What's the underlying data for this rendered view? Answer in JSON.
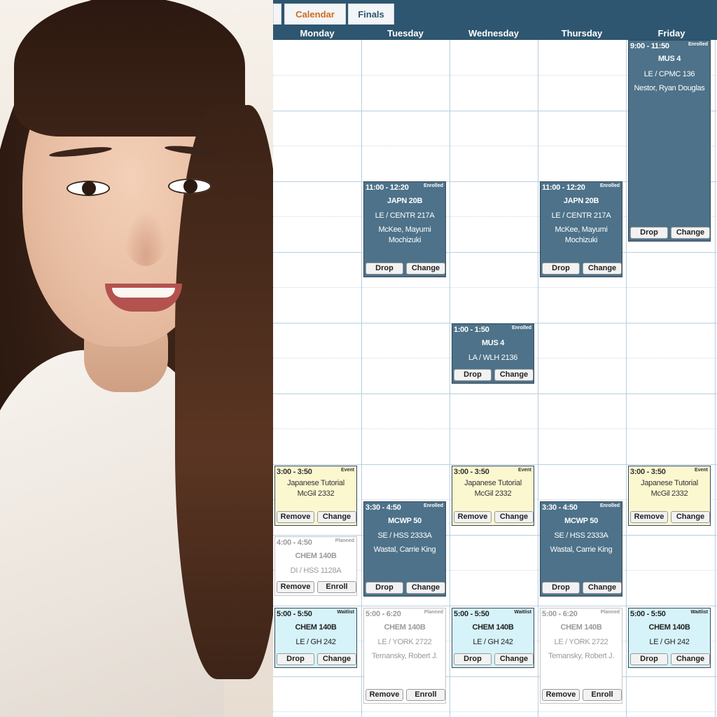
{
  "tabs": {
    "calendar": "Calendar",
    "finals": "Finals"
  },
  "days": [
    "Monday",
    "Tuesday",
    "Wednesday",
    "Thursday",
    "Friday"
  ],
  "events": {
    "fri_mus4": {
      "time": "9:00 - 11:50",
      "status": "Enrolled",
      "title": "MUS 4",
      "loc": "LE / CPMC 136",
      "instr": "Nestor, Ryan Douglas",
      "b1": "Drop",
      "b2": "Change"
    },
    "tue_japn": {
      "time": "11:00 - 12:20",
      "status": "Enrolled",
      "title": "JAPN 20B",
      "loc": "LE / CENTR 217A",
      "instr1": "McKee, Mayumi",
      "instr2": "Mochizuki",
      "b1": "Drop",
      "b2": "Change"
    },
    "thu_japn": {
      "time": "11:00 - 12:20",
      "status": "Enrolled",
      "title": "JAPN 20B",
      "loc": "LE / CENTR 217A",
      "instr1": "McKee, Mayumi",
      "instr2": "Mochizuki",
      "b1": "Drop",
      "b2": "Change"
    },
    "wed_mus4": {
      "time": "1:00 - 1:50",
      "status": "Enrolled",
      "title": "MUS 4",
      "loc": "LA / WLH 2136",
      "b1": "Drop",
      "b2": "Change"
    },
    "mon_tut": {
      "time": "3:00 - 3:50",
      "status": "Event",
      "title": "Japanese Tutorial",
      "loc": "McGil 2332",
      "b1": "Remove",
      "b2": "Change"
    },
    "wed_tut": {
      "time": "3:00 - 3:50",
      "status": "Event",
      "title": "Japanese Tutorial",
      "loc": "McGil 2332",
      "b1": "Remove",
      "b2": "Change"
    },
    "fri_tut": {
      "time": "3:00 - 3:50",
      "status": "Event",
      "title": "Japanese Tutorial",
      "loc": "McGil 2332",
      "b1": "Remove",
      "b2": "Change"
    },
    "tue_mcwp": {
      "time": "3:30 - 4:50",
      "status": "Enrolled",
      "title": "MCWP 50",
      "loc": "SE / HSS 2333A",
      "instr": "Wastal, Carrie King",
      "b1": "Drop",
      "b2": "Change"
    },
    "thu_mcwp": {
      "time": "3:30 - 4:50",
      "status": "Enrolled",
      "title": "MCWP 50",
      "loc": "SE / HSS 2333A",
      "instr": "Wastal, Carrie King",
      "b1": "Drop",
      "b2": "Change"
    },
    "mon_chem_di": {
      "time": "4:00 - 4:50",
      "status": "Planned",
      "title": "CHEM 140B",
      "loc": "DI / HSS 1128A",
      "b1": "Remove",
      "b2": "Enroll"
    },
    "mon_chem_wl": {
      "time": "5:00 - 5:50",
      "status": "Waitlist",
      "title": "CHEM 140B",
      "loc": "LE / GH 242",
      "b1": "Drop",
      "b2": "Change"
    },
    "wed_chem_wl": {
      "time": "5:00 - 5:50",
      "status": "Waitlist",
      "title": "CHEM 140B",
      "loc": "LE / GH 242",
      "b1": "Drop",
      "b2": "Change"
    },
    "fri_chem_wl": {
      "time": "5:00 - 5:50",
      "status": "Waitlist",
      "title": "CHEM 140B",
      "loc": "LE / GH 242",
      "b1": "Drop",
      "b2": "Change"
    },
    "tue_chem_pl": {
      "time": "5:00 - 6:20",
      "status": "Planned",
      "title": "CHEM 140B",
      "loc": "LE / YORK 2722",
      "instr": "Ternansky, Robert J.",
      "b1": "Remove",
      "b2": "Enroll"
    },
    "thu_chem_pl": {
      "time": "5:00 - 6:20",
      "status": "Planned",
      "title": "CHEM 140B",
      "loc": "LE / YORK 2722",
      "instr": "Ternansky, Robert J.",
      "b1": "Remove",
      "b2": "Enroll"
    }
  }
}
